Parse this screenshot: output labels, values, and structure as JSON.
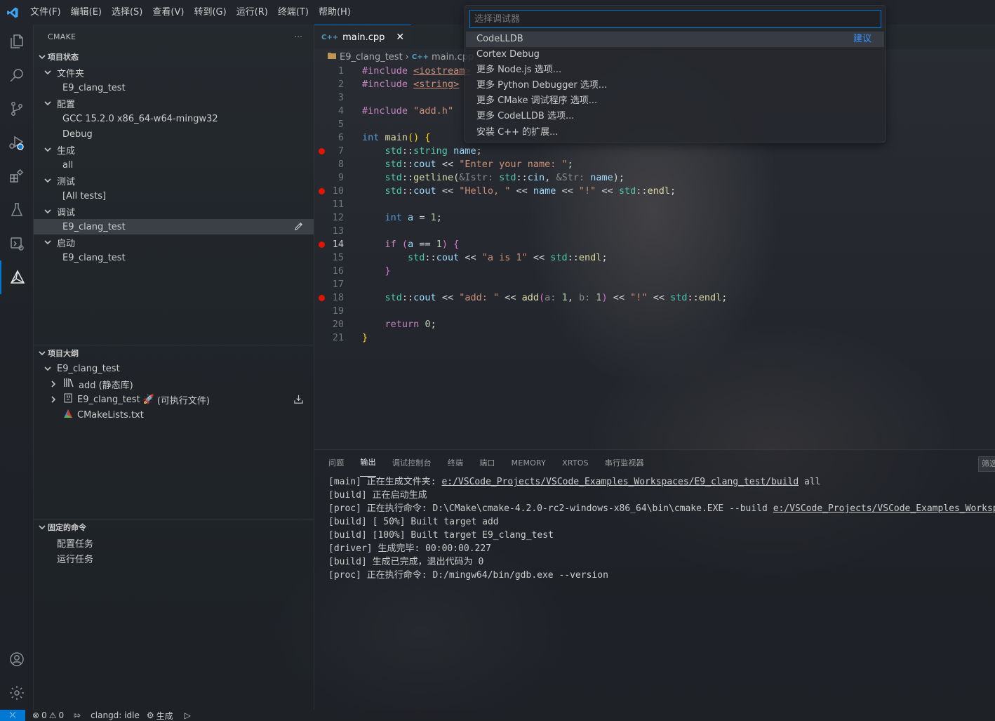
{
  "menu": [
    "文件(F)",
    "编辑(E)",
    "选择(S)",
    "查看(V)",
    "转到(G)",
    "运行(R)",
    "终端(T)",
    "帮助(H)"
  ],
  "sidebar": {
    "title": "CMAKE",
    "more": "···",
    "project_status": "项目状态",
    "folder": "文件夹",
    "folder_value": "E9_clang_test",
    "config": "配置",
    "config_kit": "GCC 15.2.0 x86_64-w64-mingw32",
    "config_type": "Debug",
    "build": "生成",
    "build_target": "all",
    "test": "测试",
    "test_value": "[All tests]",
    "debug": "调试",
    "debug_value": "E9_clang_test",
    "launch": "启动",
    "launch_value": "E9_clang_test",
    "outline": "项目大纲",
    "outline_project": "E9_clang_test",
    "outline_add": "add (静态库)",
    "outline_exe": "E9_clang_test",
    "outline_exe_suffix": "(可执行文件)",
    "outline_cmakelists": "CMakeLists.txt",
    "pinned": "固定的命令",
    "pinned_config": "配置任务",
    "pinned_run": "运行任务"
  },
  "tab": {
    "label": "main.cpp",
    "icon": "C++"
  },
  "breadcrumb": {
    "folder": "E9_clang_test",
    "file": "main.cpp"
  },
  "quickpick": {
    "placeholder": "选择调试器",
    "items": [
      "CodeLLDB",
      "Cortex Debug",
      "更多 Node.js 选项...",
      "更多 Python Debugger 选项...",
      "更多 CMake 调试程序 选项...",
      "更多 CodeLLDB 选项...",
      "安装 C++ 的扩展..."
    ],
    "recommended": "建议"
  },
  "code": {
    "line_numbers": [
      "1",
      "2",
      "3",
      "4",
      "5",
      "6",
      "7",
      "8",
      "9",
      "10",
      "11",
      "12",
      "13",
      "14",
      "15",
      "16",
      "17",
      "18",
      "19",
      "20",
      "21"
    ],
    "l1_kw": "#include",
    "l1_inc": "<iostream>",
    "l2_kw": "#include",
    "l2_inc": "<string>",
    "l4_kw": "#include",
    "l4_inc": "\"add.h\"",
    "l6_type": "int",
    "l6_fn": "main",
    "l6_rest": "() {",
    "l7_ns": "std",
    "l7_type": "string",
    "l7_var": "name",
    "l8_ns": "std",
    "l8_fn": "cout",
    "l8_str": "\"Enter your name: \"",
    "l9_ns": "std",
    "l9_fn": "getline",
    "l9_hint1": "&Istr:",
    "l9_ns2": "std",
    "l9_var": "cin",
    "l9_hint2": "&Str:",
    "l9_var2": "name",
    "l10_ns": "std",
    "l10_fn": "cout",
    "l10_str1": "\"Hello, \"",
    "l10_var": "name",
    "l10_str2": "\"!\"",
    "l10_ns2": "std",
    "l10_endl": "endl",
    "l12_type": "int",
    "l12_var": "a",
    "l12_num": "1",
    "l14_kw": "if",
    "l14_var": "a",
    "l14_num": "1",
    "l15_ns": "std",
    "l15_fn": "cout",
    "l15_str": "\"a is 1\"",
    "l15_ns2": "std",
    "l15_endl": "endl",
    "l18_ns": "std",
    "l18_fn": "cout",
    "l18_str": "\"add: \"",
    "l18_fn2": "add",
    "l18_h1": "a:",
    "l18_n1": "1",
    "l18_h2": "b:",
    "l18_n2": "1",
    "l18_str2": "\"!\"",
    "l18_ns2": "std",
    "l18_endl": "endl",
    "l20_kw": "return",
    "l20_num": "0"
  },
  "panel": {
    "tabs": [
      "问题",
      "输出",
      "调试控制台",
      "终端",
      "端口",
      "MEMORY",
      "XRTOS",
      "串行监视器"
    ],
    "filter": "筛选",
    "output": [
      "[main] 正在生成文件夹: ",
      "[build] 正在启动生成",
      "[proc] 正在执行命令: D:\\CMake\\cmake-4.2.0-rc2-windows-x86_64\\bin\\cmake.EXE --build ",
      "[build] [ 50%] Built target add",
      "[build] [100%] Built target E9_clang_test",
      "[driver] 生成完毕: 00:00:00.227",
      "[build] 生成已完成，退出代码为 0",
      "[proc] 正在执行命令: D:/mingw64/bin/gdb.exe --version"
    ],
    "out0_link": "e:/VSCode_Projects/VSCode_Examples_Workspaces/E9_clang_test/build",
    "out0_tail": " all",
    "out2_link": "e:/VSCode_Projects/VSCode_Examples_Workspa"
  },
  "statusbar": {
    "errors": "0",
    "warnings": "0",
    "clangd": "clangd: idle",
    "build": "生成"
  }
}
